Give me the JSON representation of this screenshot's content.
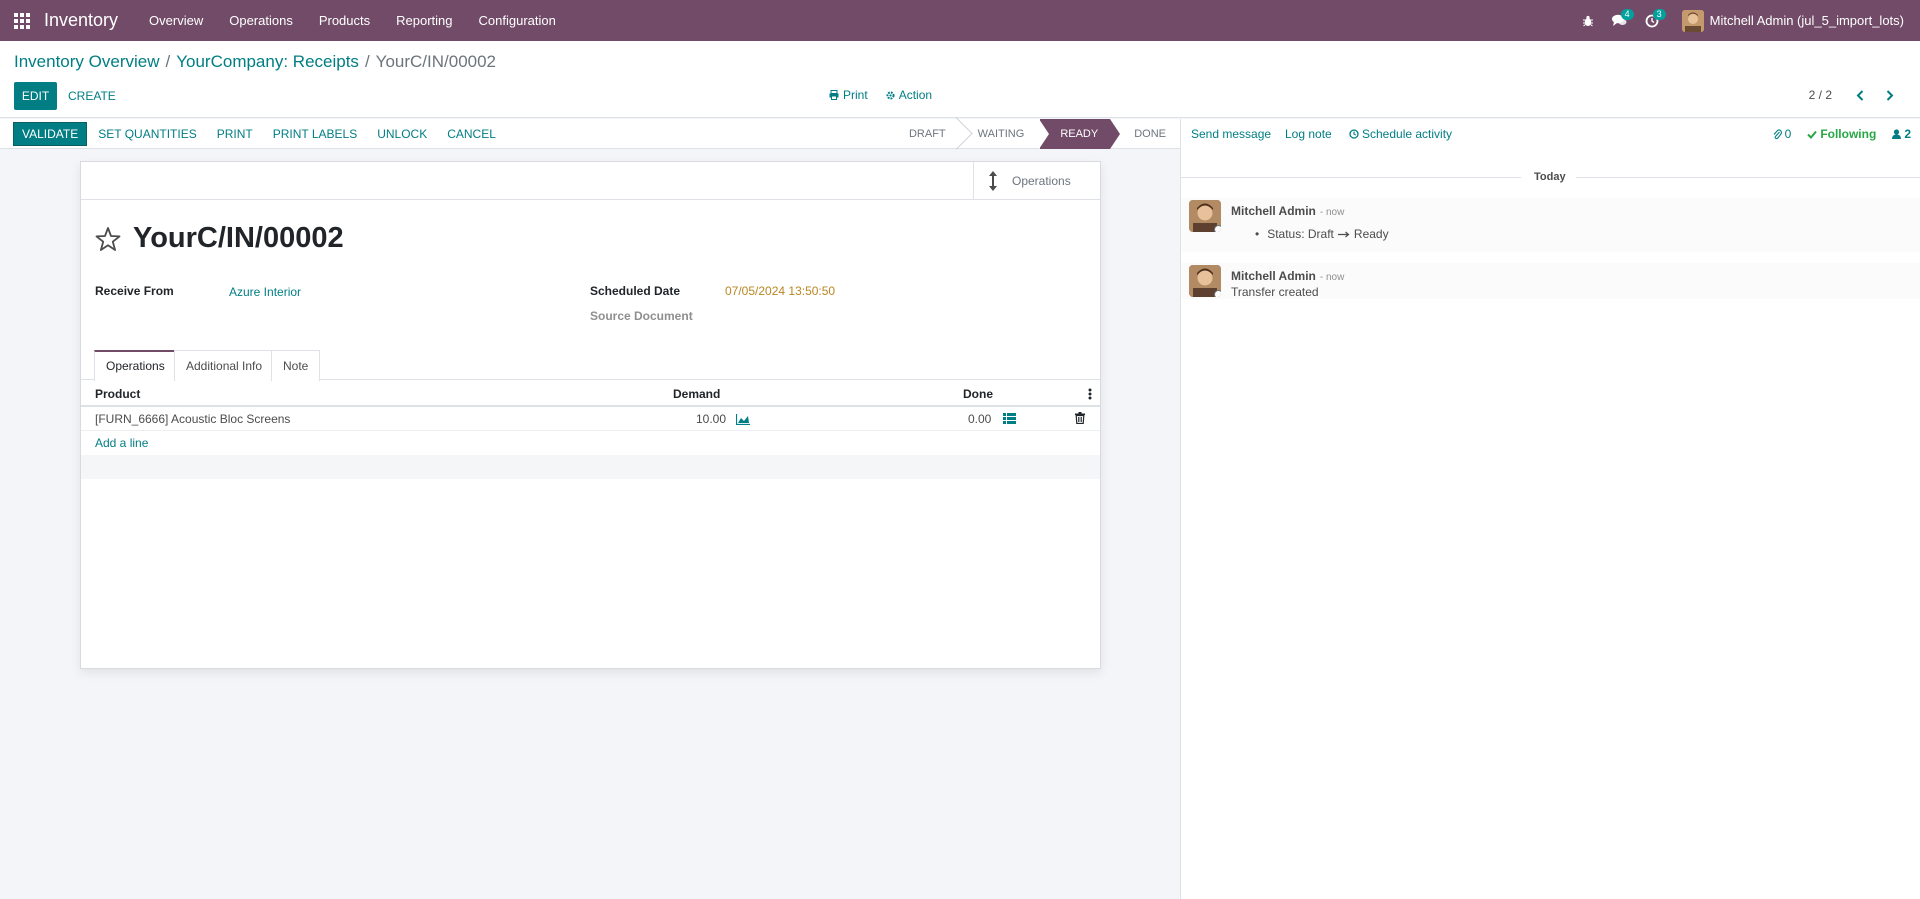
{
  "navbar": {
    "app_name": "Inventory",
    "menu": [
      "Overview",
      "Operations",
      "Products",
      "Reporting",
      "Configuration"
    ],
    "messages_count": "4",
    "activities_count": "3",
    "user_name": "Mitchell Admin (jul_5_import_lots)"
  },
  "control_panel": {
    "breadcrumb": [
      "Inventory Overview",
      "YourCompany: Receipts",
      "YourC/IN/00002"
    ],
    "edit_label": "EDIT",
    "create_label": "CREATE",
    "print_label": "Print",
    "action_label": "Action",
    "pager": "2 / 2"
  },
  "statusbar": {
    "buttons": [
      "VALIDATE",
      "SET QUANTITIES",
      "PRINT",
      "PRINT LABELS",
      "UNLOCK",
      "CANCEL"
    ],
    "stages": [
      "DRAFT",
      "WAITING",
      "READY",
      "DONE"
    ],
    "active_stage": "READY"
  },
  "form": {
    "smart_button_label": "Operations",
    "record_name": "YourC/IN/00002",
    "receive_from_label": "Receive From",
    "receive_from_value": "Azure Interior",
    "scheduled_date_label": "Scheduled Date",
    "scheduled_date_value": "07/05/2024 13:50:50",
    "source_document_label": "Source Document",
    "tabs": [
      "Operations",
      "Additional Info",
      "Note"
    ],
    "columns": {
      "product": "Product",
      "demand": "Demand",
      "done": "Done"
    },
    "rows": [
      {
        "product": "[FURN_6666] Acoustic Bloc Screens",
        "demand": "10.00",
        "done": "0.00"
      }
    ],
    "add_line_label": "Add a line"
  },
  "chatter": {
    "send_message": "Send message",
    "log_note": "Log note",
    "schedule_activity": "Schedule activity",
    "attachments_count": "0",
    "following_label": "Following",
    "followers_count": "2",
    "date_separator": "Today",
    "messages": [
      {
        "author": "Mitchell Admin",
        "date": "- now",
        "tracking": "Status: Draft",
        "tracking_new": "Ready"
      },
      {
        "author": "Mitchell Admin",
        "date": "- now",
        "body": "Transfer created"
      }
    ]
  },
  "colors": {
    "brand": "#714b67",
    "accent": "#017e84",
    "date": "#b98722",
    "following": "#28a745"
  }
}
